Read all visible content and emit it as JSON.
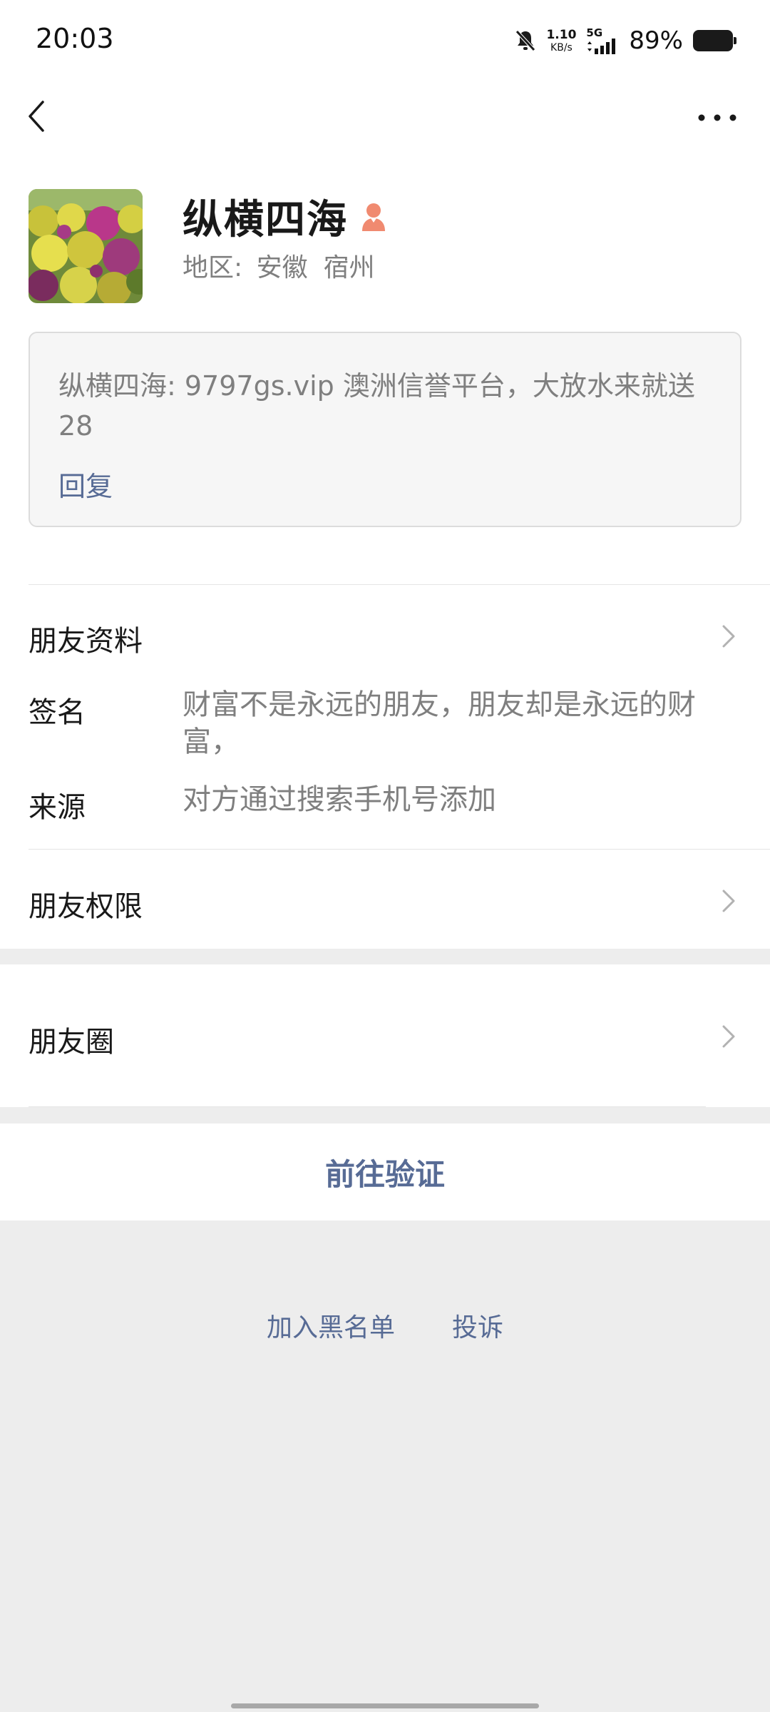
{
  "status_bar": {
    "time": "20:03",
    "net_speed_value": "1.10",
    "net_speed_unit": "KB/s",
    "network_type": "5G",
    "battery_percent": "89%",
    "icons": [
      "bell-muted-icon",
      "signal-icon",
      "battery-icon"
    ]
  },
  "nav": {
    "back_icon": "chevron-left-icon",
    "more_icon": "more-dots-icon"
  },
  "profile": {
    "name": "纵横四海",
    "gender_icon": "female-icon",
    "gender_color": "#fa5151",
    "region_label": "地区:",
    "region_province": "安徽",
    "region_city": "宿州"
  },
  "message": {
    "text": "纵横四海: 9797gs.vip  澳洲信誉平台，大放水来就送28",
    "reply_label": "回复"
  },
  "friend_profile": {
    "title": "朋友资料",
    "signature_label": "签名",
    "signature_value": "财富不是永远的朋友，朋友却是永远的财富，",
    "source_label": "来源",
    "source_value": "对方通过搜索手机号添加"
  },
  "permissions": {
    "title": "朋友权限"
  },
  "moments": {
    "title": "朋友圈"
  },
  "verify": {
    "label": "前往验证"
  },
  "bottom_links": {
    "blacklist": "加入黑名单",
    "report": "投诉"
  },
  "colors": {
    "link": "#576b95",
    "secondary_text": "#7f7f7f",
    "background": "#ededed"
  }
}
